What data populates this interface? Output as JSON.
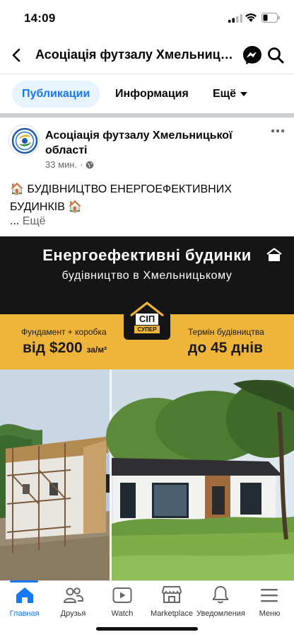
{
  "status_bar": {
    "time": "14:09"
  },
  "header": {
    "title": "Асоціація футзалу Хмельниць..."
  },
  "tabs": {
    "items": [
      {
        "label": "Публикации",
        "active": true
      },
      {
        "label": "Информация"
      },
      {
        "label": "Ещё"
      }
    ]
  },
  "post": {
    "page_name": "Асоціація футзалу Хмельницької області",
    "time": "33 мин.",
    "dot": "·",
    "text": "🏠 БУДІВНИЦТВО ЕНЕРГОЕФЕКТИВНИХ БУДИНКІВ 🏠",
    "ellipsis": "...",
    "see_more": "Ещё"
  },
  "ad": {
    "title": "Енергоефективні будинки",
    "subtitle": "будівництво в Хмельницькому",
    "logo_top": "СІП",
    "logo_bottom": "СУПЕР",
    "left_label": "Фундамент + коробка",
    "left_value": "від $200",
    "left_unit": "за/м²",
    "right_label": "Термін будівництва",
    "right_value": "до 45 днів"
  },
  "bottom_nav": {
    "items": [
      {
        "label": "Главная",
        "icon": "home-icon",
        "active": true
      },
      {
        "label": "Друзья",
        "icon": "friends-icon"
      },
      {
        "label": "Watch",
        "icon": "watch-icon"
      },
      {
        "label": "Marketplace",
        "icon": "marketplace-icon"
      },
      {
        "label": "Уведомления",
        "icon": "bell-icon"
      },
      {
        "label": "Меню",
        "icon": "menu-icon"
      }
    ]
  },
  "colors": {
    "accent": "#1877f2",
    "ad_yellow": "#efb43a",
    "ad_dark": "#151515"
  }
}
